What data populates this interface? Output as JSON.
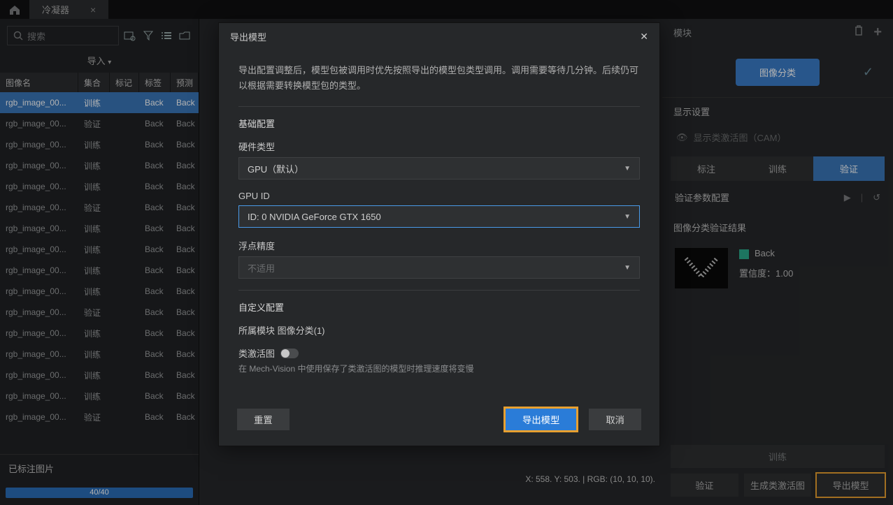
{
  "top": {
    "tab_title": "冷凝器"
  },
  "left": {
    "search_placeholder": "搜索",
    "import_label": "导入",
    "headers": {
      "name": "图像名",
      "set": "集合",
      "mark": "标记",
      "tag": "标签",
      "pre": "预测"
    },
    "rows": [
      {
        "name": "rgb_image_00...",
        "set": "训练",
        "tag": "Back",
        "pre": "Back",
        "sel": true
      },
      {
        "name": "rgb_image_00...",
        "set": "验证",
        "tag": "Back",
        "pre": "Back",
        "sel": false
      },
      {
        "name": "rgb_image_00...",
        "set": "训练",
        "tag": "Back",
        "pre": "Back",
        "sel": false
      },
      {
        "name": "rgb_image_00...",
        "set": "训练",
        "tag": "Back",
        "pre": "Back",
        "sel": false
      },
      {
        "name": "rgb_image_00...",
        "set": "训练",
        "tag": "Back",
        "pre": "Back",
        "sel": false
      },
      {
        "name": "rgb_image_00...",
        "set": "验证",
        "tag": "Back",
        "pre": "Back",
        "sel": false
      },
      {
        "name": "rgb_image_00...",
        "set": "训练",
        "tag": "Back",
        "pre": "Back",
        "sel": false
      },
      {
        "name": "rgb_image_00...",
        "set": "训练",
        "tag": "Back",
        "pre": "Back",
        "sel": false
      },
      {
        "name": "rgb_image_00...",
        "set": "训练",
        "tag": "Back",
        "pre": "Back",
        "sel": false
      },
      {
        "name": "rgb_image_00...",
        "set": "训练",
        "tag": "Back",
        "pre": "Back",
        "sel": false
      },
      {
        "name": "rgb_image_00...",
        "set": "验证",
        "tag": "Back",
        "pre": "Back",
        "sel": false
      },
      {
        "name": "rgb_image_00...",
        "set": "训练",
        "tag": "Back",
        "pre": "Back",
        "sel": false
      },
      {
        "name": "rgb_image_00...",
        "set": "训练",
        "tag": "Back",
        "pre": "Back",
        "sel": false
      },
      {
        "name": "rgb_image_00...",
        "set": "训练",
        "tag": "Back",
        "pre": "Back",
        "sel": false
      },
      {
        "name": "rgb_image_00...",
        "set": "训练",
        "tag": "Back",
        "pre": "Back",
        "sel": false
      },
      {
        "name": "rgb_image_00...",
        "set": "验证",
        "tag": "Back",
        "pre": "Back",
        "sel": false
      }
    ],
    "footer_label": "已标注图片",
    "progress_text": "40/40"
  },
  "status": "X: 558. Y: 503. | RGB: (10, 10, 10).",
  "right": {
    "module_label": "模块",
    "module_btn": "图像分类",
    "display_settings": "显示设置",
    "cam_label": "显示类激活图（CAM）",
    "tabs": {
      "annotate": "标注",
      "train": "训练",
      "validate": "验证"
    },
    "param_title": "验证参数配置",
    "result_title": "图像分类验证结果",
    "result_class": "Back",
    "confidence_label": "置信度：",
    "confidence_value": "1.00",
    "btn_train": "训练",
    "btn_validate": "验证",
    "btn_cam": "生成类激活图",
    "btn_export": "导出模型"
  },
  "modal": {
    "title": "导出模型",
    "desc": "导出配置调整后，模型包被调用时优先按照导出的模型包类型调用。调用需要等待几分钟。后续仍可以根据需要转换模型包的类型。",
    "section_basic": "基础配置",
    "hw_label": "硬件类型",
    "hw_value": "GPU（默认）",
    "gpu_label": "GPU ID",
    "gpu_value": "ID: 0  NVIDIA GeForce GTX 1650",
    "fp_label": "浮点精度",
    "fp_value": "不适用",
    "section_custom": "自定义配置",
    "module_label": "所属模块 图像分类(1)",
    "cam_label": "类激活图",
    "cam_hint": "在 Mech-Vision 中使用保存了类激活图的模型时推理速度将变慢",
    "btn_reset": "重置",
    "btn_export": "导出模型",
    "btn_cancel": "取消"
  }
}
